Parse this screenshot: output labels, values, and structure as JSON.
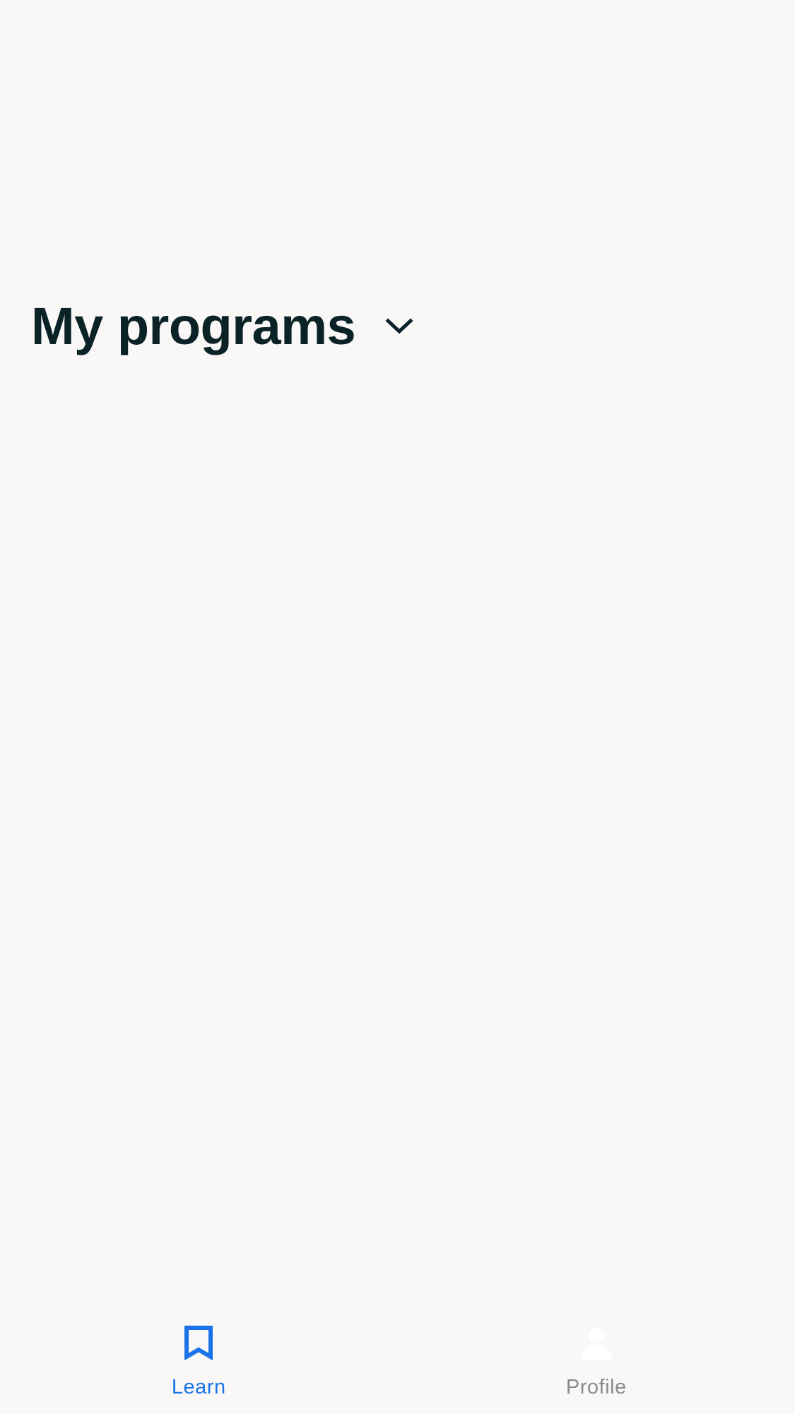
{
  "header": {
    "title": "My programs",
    "dropdown_icon": "chevron-down-icon"
  },
  "tabbar": {
    "tabs": [
      {
        "label": "Learn",
        "icon": "bookmark-icon",
        "active": true
      },
      {
        "label": "Profile",
        "icon": "user-icon",
        "active": false
      }
    ]
  },
  "colors": {
    "background": "#f9f8f7",
    "title": "#0b2227",
    "accent": "#1a73e8",
    "inactive": "#8a8a8a"
  }
}
